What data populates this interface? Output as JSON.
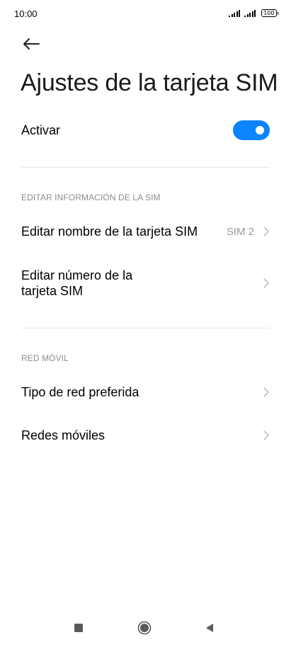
{
  "status_bar": {
    "time": "10:00",
    "battery_level": "100"
  },
  "page": {
    "title": "Ajustes de la tarjeta SIM"
  },
  "activate": {
    "label": "Activar",
    "enabled": true
  },
  "sections": {
    "sim_info": {
      "header": "EDITAR INFORMACIÓN DE LA SIM",
      "edit_name": {
        "label": "Editar nombre de la tarjeta SIM",
        "value": "SIM 2"
      },
      "edit_number": {
        "label_line1": "Editar número de la",
        "label_line2": "tarjeta SIM"
      }
    },
    "mobile_network": {
      "header": "RED MÓVIL",
      "preferred_network": {
        "label": "Tipo de red preferida"
      },
      "mobile_networks": {
        "label": "Redes móviles"
      }
    }
  },
  "colors": {
    "accent": "#0d84ff",
    "secondary_text": "#8c8c8c",
    "divider": "#e6e6e6"
  },
  "icons": {
    "back": "arrow-left-icon",
    "chevron": "chevron-right-icon",
    "nav_recents": "square-icon",
    "nav_home": "circle-icon",
    "nav_back": "triangle-back-icon"
  }
}
